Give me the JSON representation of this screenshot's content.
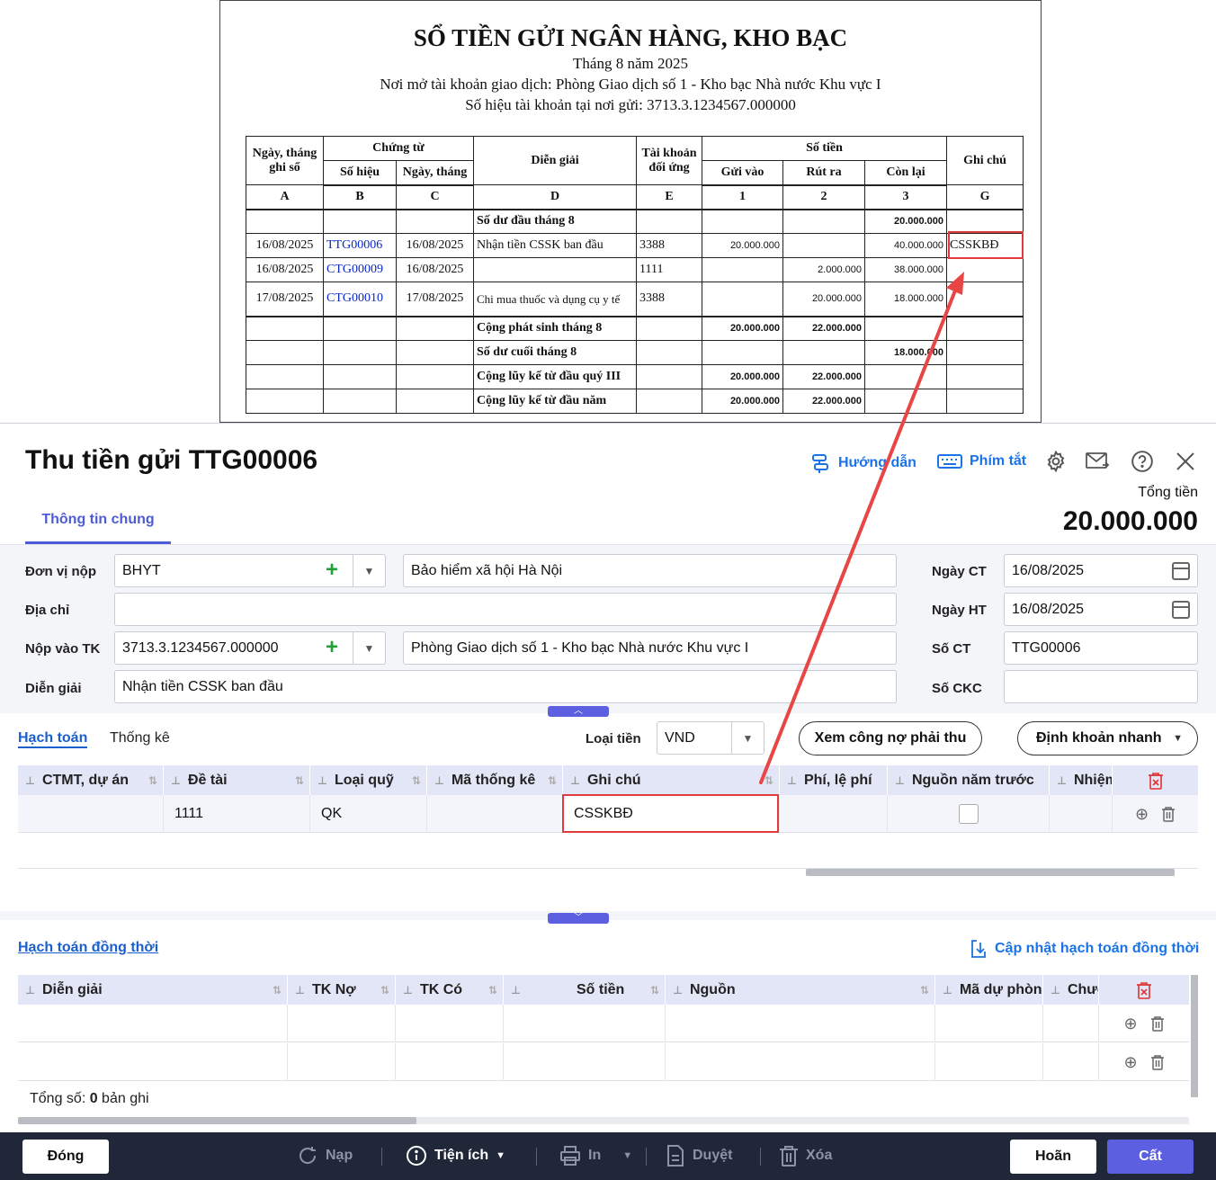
{
  "report": {
    "title": "SỔ TIỀN GỬI NGÂN HÀNG, KHO BẠC",
    "period": "Tháng 8 năm 2025",
    "open_place": "Nơi mở tài khoản giao dịch: Phòng Giao dịch số 1 - Kho bạc Nhà nước Khu vực I",
    "account_no": "Số hiệu tài khoản tại nơi gửi: 3713.3.1234567.000000",
    "headers": {
      "date": "Ngày, tháng ghi sổ",
      "voucher": "Chứng từ",
      "voucher_no": "Số hiệu",
      "voucher_date": "Ngày, tháng",
      "desc": "Diễn giải",
      "contra": "Tài khoản đối ứng",
      "amount": "Số tiền",
      "in": "Gửi vào",
      "out": "Rút ra",
      "balance": "Còn lại",
      "note": "Ghi chú"
    },
    "codes": [
      "A",
      "B",
      "C",
      "D",
      "E",
      "1",
      "2",
      "3",
      "G"
    ],
    "opening": {
      "label": "Số dư đầu tháng 8",
      "balance": "20.000.000"
    },
    "rows": [
      {
        "date": "16/08/2025",
        "no": "TTG00006",
        "vdate": "16/08/2025",
        "desc": "Nhận tiền CSSK ban đầu",
        "acc": "3388",
        "in": "20.000.000",
        "out": "",
        "bal": "40.000.000",
        "note": "CSSKBĐ"
      },
      {
        "date": "16/08/2025",
        "no": "CTG00009",
        "vdate": "16/08/2025",
        "desc": "",
        "acc": "1111",
        "in": "",
        "out": "2.000.000",
        "bal": "38.000.000",
        "note": ""
      },
      {
        "date": "17/08/2025",
        "no": "CTG00010",
        "vdate": "17/08/2025",
        "desc": "Chi mua thuốc và dụng cụ y tế",
        "acc": "3388",
        "in": "",
        "out": "20.000.000",
        "bal": "18.000.000",
        "note": ""
      }
    ],
    "totals": [
      {
        "label": "Cộng phát sinh tháng 8",
        "in": "20.000.000",
        "out": "22.000.000",
        "bal": ""
      },
      {
        "label": "Số dư cuối tháng 8",
        "in": "",
        "out": "",
        "bal": "18.000.000"
      },
      {
        "label": "Cộng lũy kế từ đầu quý III",
        "in": "20.000.000",
        "out": "22.000.000",
        "bal": ""
      },
      {
        "label": "Cộng lũy kế từ đầu năm",
        "in": "20.000.000",
        "out": "22.000.000",
        "bal": ""
      }
    ]
  },
  "dialog": {
    "title": "Thu tiền gửi TTG00006",
    "guide": "Hướng dẫn",
    "shortcuts": "Phím tắt",
    "total_label": "Tổng tiền",
    "total_value": "20.000.000",
    "tab_general": "Thông tin chung",
    "form": {
      "unit_label": "Đơn vị nộp",
      "unit_code": "BHYT",
      "unit_name": "Bảo hiểm xã hội Hà Nội",
      "address_label": "Địa chỉ",
      "address": "",
      "account_label": "Nộp vào TK",
      "account_no": "3713.3.1234567.000000",
      "account_name": "Phòng Giao dịch số 1 - Kho bạc Nhà nước Khu vực I",
      "desc_label": "Diễn giải",
      "desc": "Nhận tiền CSSK ban đầu",
      "doc_date_label": "Ngày CT",
      "doc_date": "16/08/2025",
      "post_date_label": "Ngày HT",
      "post_date": "16/08/2025",
      "doc_no_label": "Số CT",
      "doc_no": "TTG00006",
      "ckc_label": "Số CKC",
      "ckc": ""
    },
    "tabs2": {
      "accounting": "Hạch toán",
      "stats": "Thống kê"
    },
    "currency_label": "Loại tiền",
    "currency": "VND",
    "receivable_btn": "Xem công nợ phải thu",
    "quick_btn": "Định khoản nhanh",
    "grid1": {
      "headers": [
        "CTMT, dự án",
        "Đề tài",
        "Loại quỹ",
        "Mã thống kê",
        "Ghi chú",
        "Phí, lệ phí",
        "Nguồn năm trước",
        "Nhiệm"
      ],
      "row": {
        "ctmt": "",
        "topic": "1111",
        "fund": "QK",
        "stat": "",
        "note": "CSSKBĐ",
        "fee": "",
        "prev": false,
        "task": ""
      }
    },
    "simul_title": "Hạch toán đồng thời",
    "simul_update": "Cập nhật hạch toán đồng thời",
    "grid2": {
      "headers": [
        "Diễn giải",
        "TK Nợ",
        "TK Có",
        "Số tiền",
        "Nguồn",
        "Mã dự phòng",
        "Chươ"
      ]
    },
    "count_prefix": "Tổng số: ",
    "count_value": "0",
    "count_suffix": " bản ghi",
    "footer": {
      "close": "Đóng",
      "reload": "Nạp",
      "utility": "Tiện ích",
      "print": "In",
      "approve": "Duyệt",
      "delete": "Xóa",
      "cancel": "Hoãn",
      "save": "Cất"
    },
    "colors": {
      "accent": "#5b5fe0",
      "link": "#1a73e8",
      "highlight": "#e03a3a",
      "footer": "#1f2739"
    }
  }
}
